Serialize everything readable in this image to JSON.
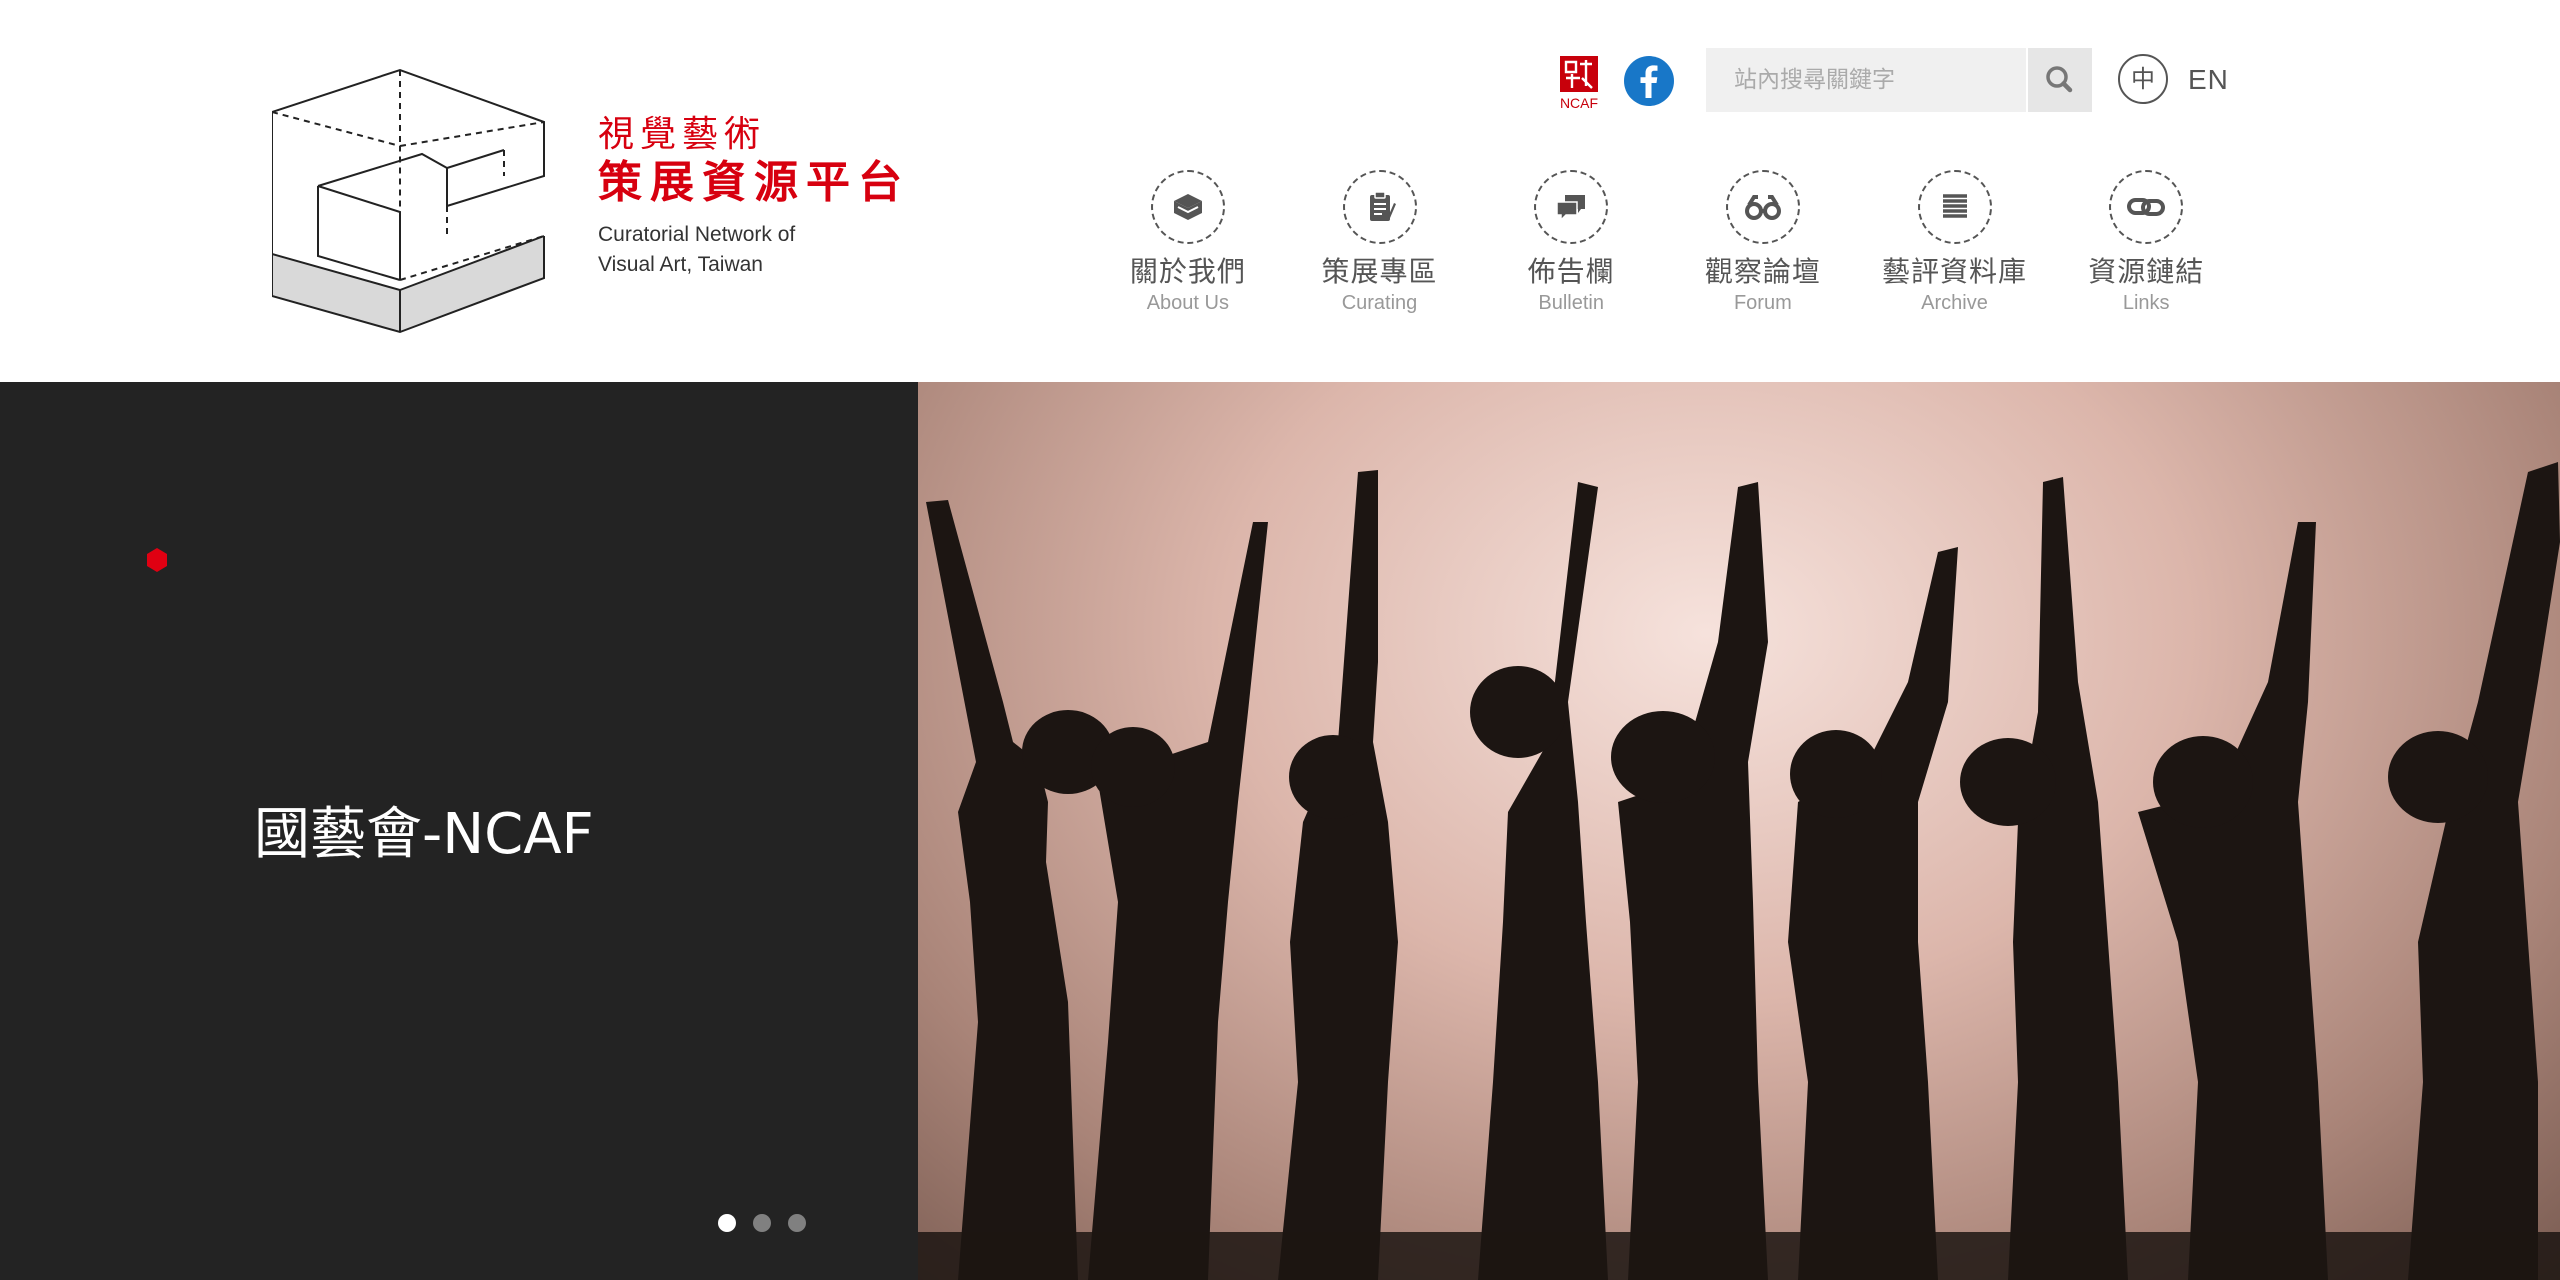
{
  "header": {
    "logo": {
      "title_line1": "視覺藝術",
      "title_line2": "策展資源平台",
      "subtitle_line1": "Curatorial Network of",
      "subtitle_line2": "Visual Art, Taiwan",
      "accent_color": "#d7000f"
    },
    "utility": {
      "ncaf_label": "NCAF",
      "search_placeholder": "站內搜尋關鍵字",
      "lang_zh": "中",
      "lang_en": "EN",
      "facebook_color": "#1877c8"
    },
    "nav": [
      {
        "zh": "關於我們",
        "en": "About Us",
        "icon": "book-icon"
      },
      {
        "zh": "策展專區",
        "en": "Curating",
        "icon": "clipboard-icon"
      },
      {
        "zh": "佈告欄",
        "en": "Bulletin",
        "icon": "chat-bubbles-icon"
      },
      {
        "zh": "觀察論壇",
        "en": "Forum",
        "icon": "glasses-icon"
      },
      {
        "zh": "藝評資料庫",
        "en": "Archive",
        "icon": "list-lines-icon"
      },
      {
        "zh": "資源鏈結",
        "en": "Links",
        "icon": "chain-link-icon"
      }
    ]
  },
  "hero": {
    "slide_title": "國藝會-NCAF",
    "slide_count": 3,
    "active_slide": 1,
    "left_panel_color": "#232323",
    "image_subject": "silhouetted-dancers"
  }
}
